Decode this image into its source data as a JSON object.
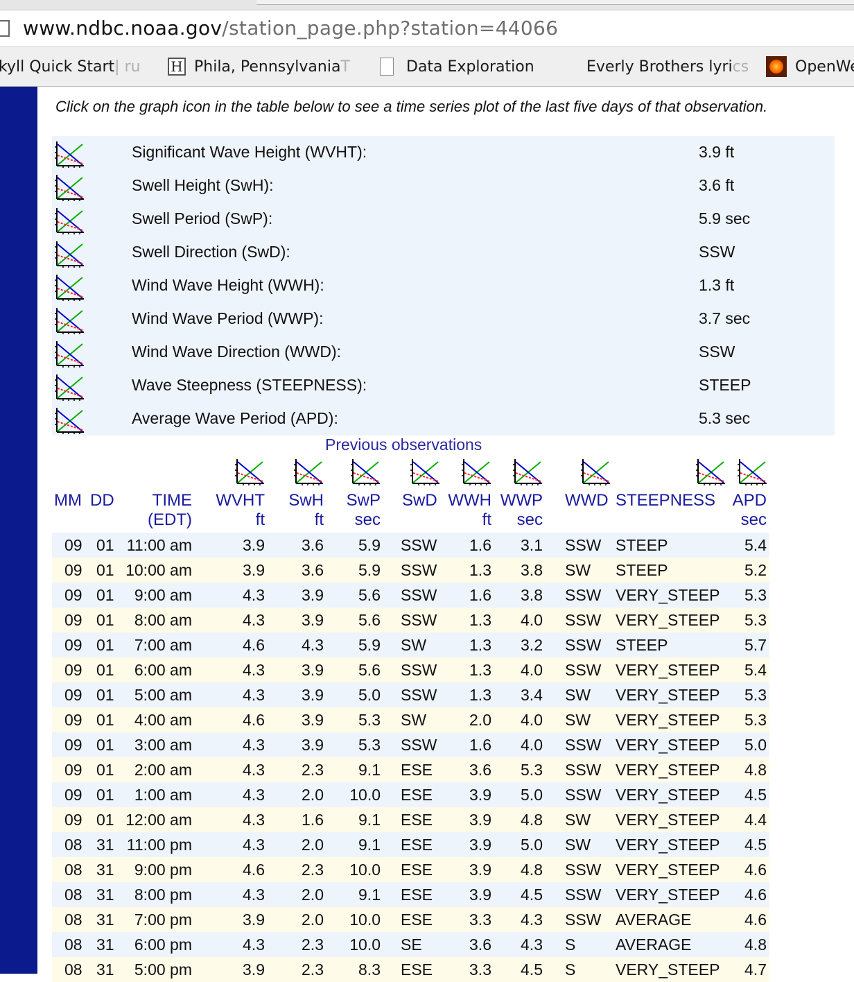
{
  "browser": {
    "url_domain": "www.ndbc.noaa.gov",
    "url_path": "/station_page.php?station=44066"
  },
  "bookmarks": [
    {
      "label": "kyll Quick Start",
      "fade": " | ru",
      "icon": "none"
    },
    {
      "label": "Phila, Pennsylvania",
      "fade": " T",
      "icon": "h-icon"
    },
    {
      "label": "Data Exploration",
      "fade": "",
      "icon": "document-icon"
    },
    {
      "label": "Everly Brothers lyri",
      "fade": "cs",
      "icon": "none"
    },
    {
      "label": "OpenWe",
      "fade": "",
      "icon": "sun-icon"
    }
  ],
  "intro": "Click on the graph icon in the table below to see a time series plot of the last five days of that observation.",
  "current": [
    {
      "label": "Significant Wave Height (WVHT):",
      "value": "3.9 ft"
    },
    {
      "label": "Swell Height (SwH):",
      "value": "3.6 ft"
    },
    {
      "label": "Swell Period (SwP):",
      "value": "5.9 sec"
    },
    {
      "label": "Swell Direction (SwD):",
      "value": "SSW"
    },
    {
      "label": "Wind Wave Height (WWH):",
      "value": "1.3 ft"
    },
    {
      "label": "Wind Wave Period (WWP):",
      "value": "3.7 sec"
    },
    {
      "label": "Wind Wave Direction (WWD):",
      "value": "SSW"
    },
    {
      "label": "Wave Steepness (STEEPNESS):",
      "value": "STEEP"
    },
    {
      "label": "Average Wave Period (APD):",
      "value": "5.3 sec"
    }
  ],
  "previous": {
    "title": "Previous observations",
    "headers": {
      "mm": "MM",
      "dd": "DD",
      "time": "TIME",
      "time_unit": "(EDT)",
      "wvht": "WVHT",
      "wvht_unit": "ft",
      "swh": "SwH",
      "swh_unit": "ft",
      "swp": "SwP",
      "swp_unit": "sec",
      "swd": "SwD",
      "wwh": "WWH",
      "wwh_unit": "ft",
      "wwp": "WWP",
      "wwp_unit": "sec",
      "wwd": "WWD",
      "steepness": "STEEPNESS",
      "apd": "APD",
      "apd_unit": "sec"
    },
    "rows": [
      [
        "09",
        "01",
        "11:00 am",
        "3.9",
        "3.6",
        "5.9",
        "SSW",
        "1.6",
        "3.1",
        "SSW",
        "STEEP",
        "5.4"
      ],
      [
        "09",
        "01",
        "10:00 am",
        "3.9",
        "3.6",
        "5.9",
        "SSW",
        "1.3",
        "3.8",
        "SW",
        "STEEP",
        "5.2"
      ],
      [
        "09",
        "01",
        "9:00 am",
        "4.3",
        "3.9",
        "5.6",
        "SSW",
        "1.6",
        "3.8",
        "SSW",
        "VERY_STEEP",
        "5.3"
      ],
      [
        "09",
        "01",
        "8:00 am",
        "4.3",
        "3.9",
        "5.6",
        "SSW",
        "1.3",
        "4.0",
        "SSW",
        "VERY_STEEP",
        "5.3"
      ],
      [
        "09",
        "01",
        "7:00 am",
        "4.6",
        "4.3",
        "5.9",
        "SW",
        "1.3",
        "3.2",
        "SSW",
        "STEEP",
        "5.7"
      ],
      [
        "09",
        "01",
        "6:00 am",
        "4.3",
        "3.9",
        "5.6",
        "SSW",
        "1.3",
        "4.0",
        "SSW",
        "VERY_STEEP",
        "5.4"
      ],
      [
        "09",
        "01",
        "5:00 am",
        "4.3",
        "3.9",
        "5.0",
        "SSW",
        "1.3",
        "3.4",
        "SW",
        "VERY_STEEP",
        "5.3"
      ],
      [
        "09",
        "01",
        "4:00 am",
        "4.6",
        "3.9",
        "5.3",
        "SW",
        "2.0",
        "4.0",
        "SW",
        "VERY_STEEP",
        "5.3"
      ],
      [
        "09",
        "01",
        "3:00 am",
        "4.3",
        "3.9",
        "5.3",
        "SSW",
        "1.6",
        "4.0",
        "SSW",
        "VERY_STEEP",
        "5.0"
      ],
      [
        "09",
        "01",
        "2:00 am",
        "4.3",
        "2.3",
        "9.1",
        "ESE",
        "3.6",
        "5.3",
        "SSW",
        "VERY_STEEP",
        "4.8"
      ],
      [
        "09",
        "01",
        "1:00 am",
        "4.3",
        "2.0",
        "10.0",
        "ESE",
        "3.9",
        "5.0",
        "SSW",
        "VERY_STEEP",
        "4.5"
      ],
      [
        "09",
        "01",
        "12:00 am",
        "4.3",
        "1.6",
        "9.1",
        "ESE",
        "3.9",
        "4.8",
        "SW",
        "VERY_STEEP",
        "4.4"
      ],
      [
        "08",
        "31",
        "11:00 pm",
        "4.3",
        "2.0",
        "9.1",
        "ESE",
        "3.9",
        "5.0",
        "SW",
        "VERY_STEEP",
        "4.5"
      ],
      [
        "08",
        "31",
        "9:00 pm",
        "4.6",
        "2.3",
        "10.0",
        "ESE",
        "3.9",
        "4.8",
        "SSW",
        "VERY_STEEP",
        "4.6"
      ],
      [
        "08",
        "31",
        "8:00 pm",
        "4.3",
        "2.0",
        "9.1",
        "ESE",
        "3.9",
        "4.5",
        "SSW",
        "VERY_STEEP",
        "4.6"
      ],
      [
        "08",
        "31",
        "7:00 pm",
        "3.9",
        "2.0",
        "10.0",
        "ESE",
        "3.3",
        "4.3",
        "SSW",
        "AVERAGE",
        "4.6"
      ],
      [
        "08",
        "31",
        "6:00 pm",
        "4.3",
        "2.3",
        "10.0",
        "SE",
        "3.6",
        "4.3",
        "S",
        "AVERAGE",
        "4.8"
      ],
      [
        "08",
        "31",
        "5:00 pm",
        "3.9",
        "2.3",
        "8.3",
        "ESE",
        "3.3",
        "4.5",
        "S",
        "VERY_STEEP",
        "4.7"
      ]
    ]
  }
}
